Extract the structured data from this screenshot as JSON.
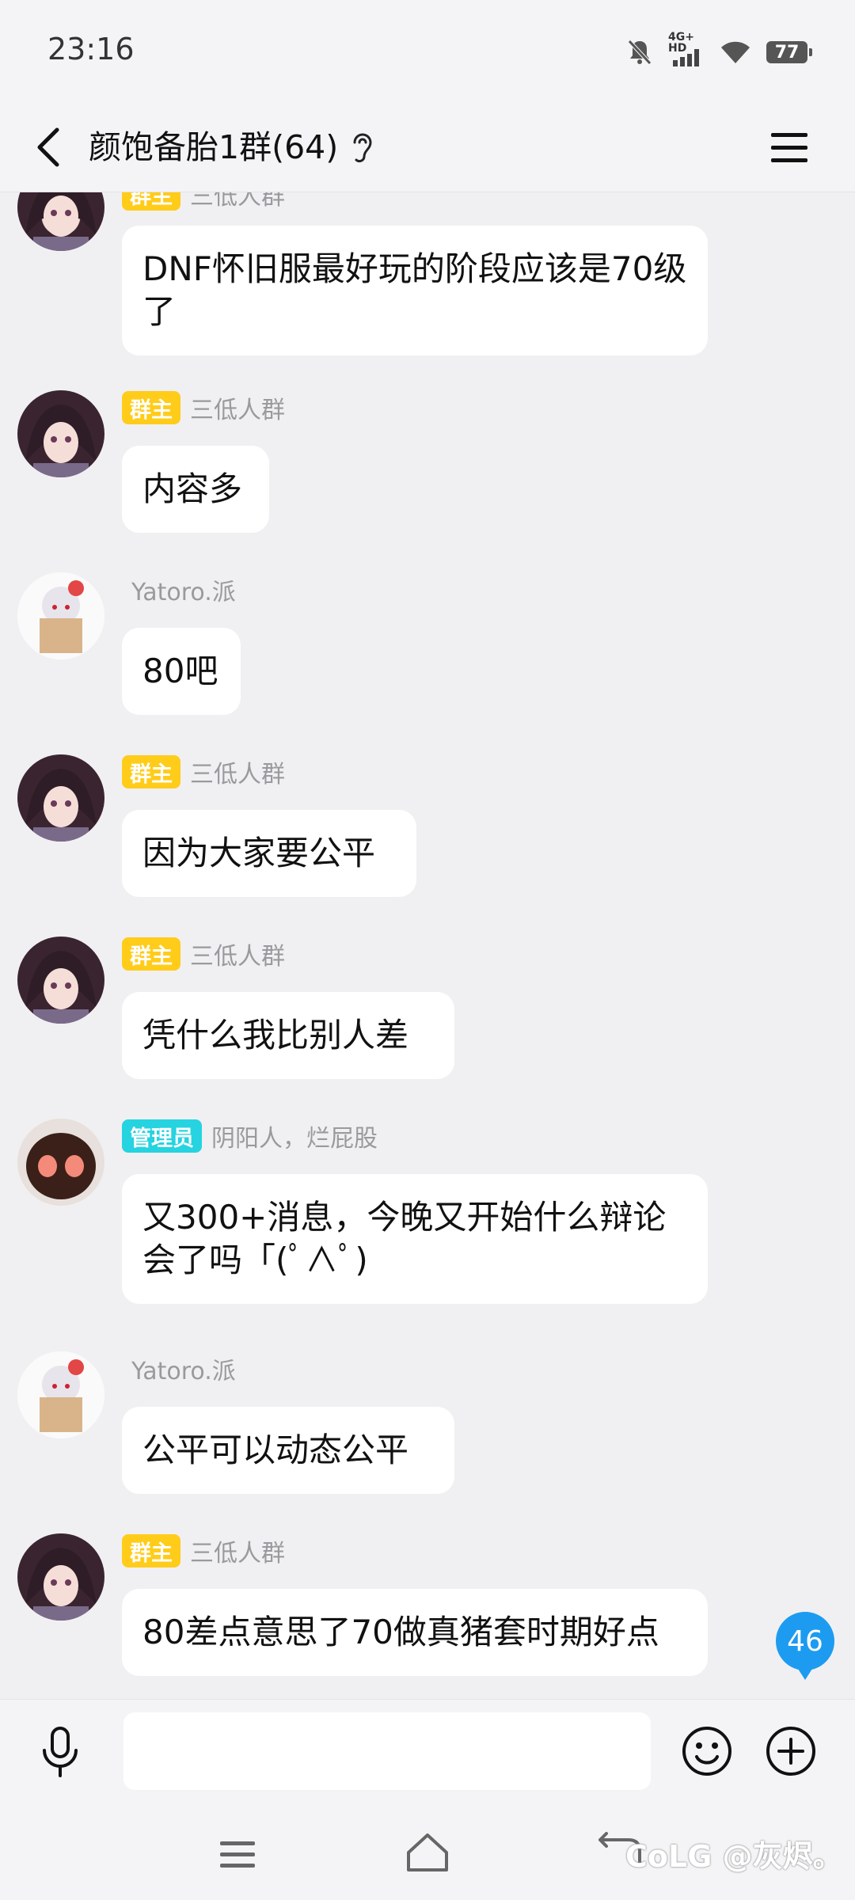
{
  "status_bar": {
    "time": "23:16",
    "network": "4G+ HD",
    "battery": "77"
  },
  "header": {
    "title": "颜饱备胎1群(64)"
  },
  "messages": [
    {
      "role": "群主",
      "sender": "三低人群",
      "text": "DNF怀旧服最好玩的阶段应该是70级了"
    },
    {
      "role": "群主",
      "sender": "三低人群",
      "text": "内容多"
    },
    {
      "role": "",
      "sender": "Yatoro.派",
      "text": "80吧"
    },
    {
      "role": "群主",
      "sender": "三低人群",
      "text": "因为大家要公平"
    },
    {
      "role": "群主",
      "sender": "三低人群",
      "text": "凭什么我比别人差"
    },
    {
      "role": "管理员",
      "sender": "阴阳人，烂屁股",
      "text": "又300+消息，今晚又开始什么辩论会了吗「(ﾟ∧ﾟ)"
    },
    {
      "role": "",
      "sender": "Yatoro.派",
      "text": "公平可以动态公平"
    },
    {
      "role": "群主",
      "sender": "三低人群",
      "text": "80差点意思了70做真猪套时期好点"
    }
  ],
  "unread_count": "46",
  "input": {
    "placeholder": ""
  },
  "watermark": "CoLG @灰烬。",
  "colors": {
    "owner_badge": "#ffcc1a",
    "admin_badge": "#26d3e0",
    "unread": "#1d9bf0"
  }
}
